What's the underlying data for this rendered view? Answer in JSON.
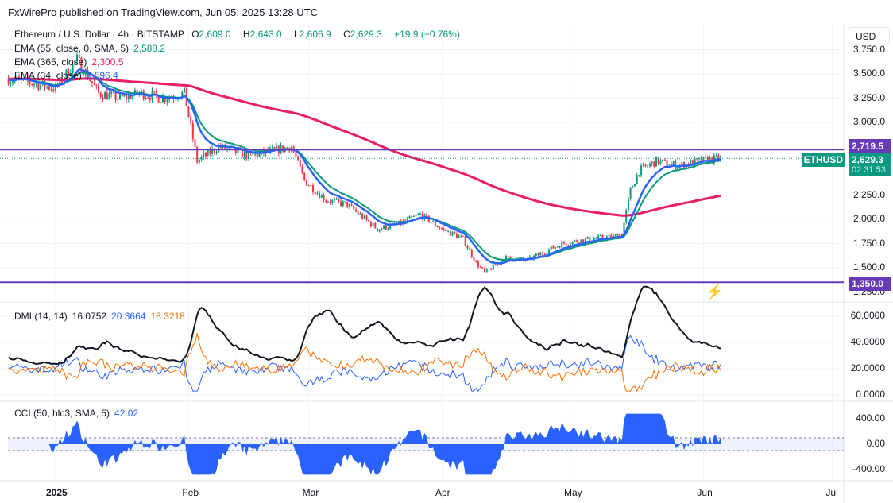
{
  "header": {
    "published": "FxWirePro published on TradingView.com, Jun 05, 2025 13:28 UTC"
  },
  "legend": {
    "symbol": "Ethereum / U.S. Dollar · 4h · BITSTAMP",
    "o_label": "O",
    "o": "2,609.0",
    "h_label": "H",
    "h": "2,643.0",
    "l_label": "L",
    "l": "2,606.9",
    "c_label": "C",
    "c": "2,629.3",
    "change": "+19.9 (+0.76%)",
    "ema55_label": "EMA (55, close, 0, SMA, 5)",
    "ema55": "2,588.2",
    "ema365_label": "EMA (365, close)",
    "ema365": "2,300.5",
    "ema34_label": "EMA (34, close)",
    "ema34": "2,596.4",
    "dmi_label": "DMI (14, 14)",
    "adx": "16.0752",
    "di_plus": "20.3664",
    "di_minus": "18.3218",
    "cci_label": "CCI (50, hlc3, SMA, 5)",
    "cci": "42.02"
  },
  "price_axis": {
    "currency": "USD",
    "ticks": [
      "3,750.0",
      "3,500.0",
      "3,250.0",
      "3,000.0",
      "2,250.0",
      "2,000.0",
      "1,750.0",
      "1,500.0",
      "1,250.0"
    ],
    "tick_values": [
      3750,
      3500,
      3250,
      3000,
      2250,
      2000,
      1750,
      1500,
      1250
    ],
    "level_high": "2,719.5",
    "level_low": "1,350.0",
    "symbol_tag": "ETHUSD",
    "last_price": "2,629.3",
    "countdown": "02:31:53"
  },
  "dmi_axis": {
    "ticks": [
      "60.0000",
      "40.0000",
      "20.0000",
      "0.0000"
    ],
    "tick_values": [
      60,
      40,
      20,
      0
    ]
  },
  "cci_axis": {
    "ticks": [
      "400.00",
      "0.00",
      "-400.00"
    ],
    "tick_values": [
      400,
      0,
      -400
    ]
  },
  "time_axis": {
    "labels": [
      "2025",
      "Feb",
      "Mar",
      "Apr",
      "May",
      "Jun",
      "Jul"
    ],
    "days": [
      0,
      31,
      59,
      90,
      120,
      151,
      181
    ]
  },
  "colors": {
    "up": "#089981",
    "down": "#f23645",
    "ema55": "#089981",
    "ema34": "#2962ff",
    "ema365": "#e91e63",
    "level": "#673ab7",
    "adx": "#131722",
    "diplus": "#2962ff",
    "diminus": "#ff6d00",
    "cci": "#2962ff"
  },
  "chart_data": {
    "type": "line",
    "title": "Ethereum / U.S. Dollar · 4h · BITSTAMP",
    "ylim": [
      1200,
      3800
    ],
    "levels": [
      2719.5,
      1350.0
    ],
    "price_keypoints_day": [
      -11,
      -5,
      0,
      5,
      10,
      15,
      20,
      25,
      30,
      33,
      38,
      45,
      55,
      58,
      63,
      68,
      75,
      80,
      85,
      90,
      95,
      98,
      100,
      105,
      110,
      118,
      125,
      130,
      132,
      134,
      136,
      140,
      145,
      150,
      155
    ],
    "price_keypoints": [
      3450,
      3400,
      3350,
      3650,
      3300,
      3250,
      3300,
      3250,
      3300,
      2600,
      2750,
      2650,
      2750,
      2400,
      2200,
      2150,
      1900,
      1950,
      2050,
      1900,
      1800,
      1550,
      1450,
      1600,
      1580,
      1750,
      1800,
      1820,
      1850,
      2300,
      2500,
      2600,
      2550,
      2600,
      2629
    ]
  }
}
